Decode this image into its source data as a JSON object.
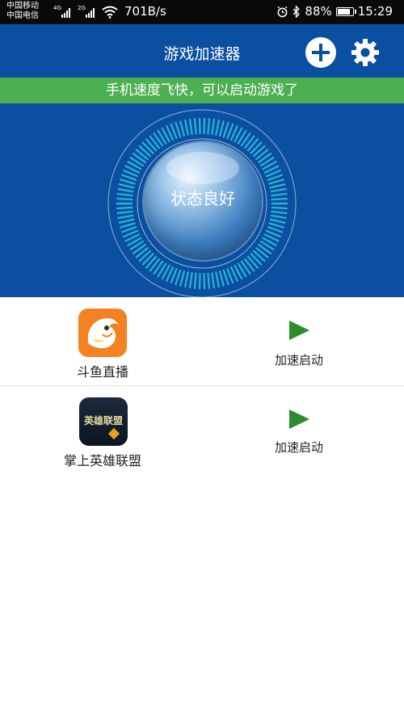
{
  "status_bar": {
    "carrier1": "中国移动",
    "carrier2": "中国电信",
    "net1": "4G",
    "net2": "2G",
    "speed": "701B/s",
    "battery": "88%",
    "battery_level": 0.88,
    "time": "15:29",
    "icons": [
      "signal-icon",
      "wifi-icon",
      "alarm-icon",
      "bluetooth-icon",
      "battery-icon"
    ]
  },
  "header": {
    "title": "游戏加速器",
    "add_icon": "plus-icon",
    "settings_icon": "gear-icon",
    "banner": "手机速度飞快，可以启动游戏了",
    "status": "状态良好"
  },
  "games": [
    {
      "name": "斗鱼直播",
      "action": "加速启动",
      "icon": "douyu-app-icon"
    },
    {
      "name": "掌上英雄联盟",
      "action": "加速启动",
      "icon": "lol-app-icon",
      "icon_text": "英雄联盟"
    }
  ],
  "colors": {
    "primary": "#0a4fa0",
    "banner": "#4caf50",
    "gauge": "#29b6d8",
    "play": "#2e8b2e"
  }
}
